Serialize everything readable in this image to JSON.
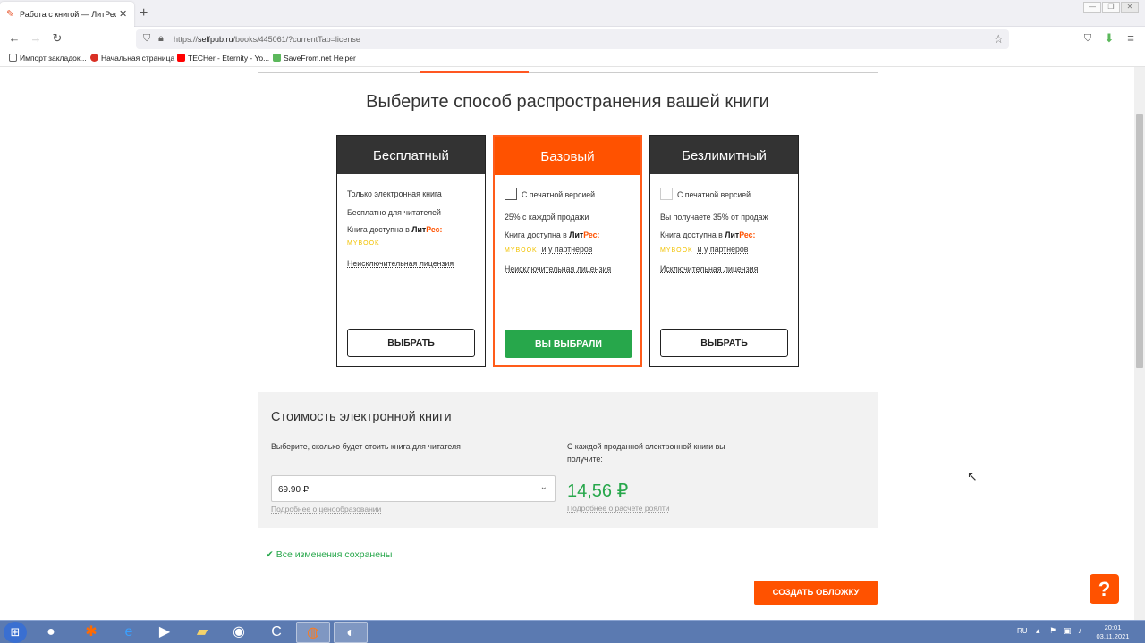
{
  "browser": {
    "tab_title": "Работа с книгой — ЛитРес: Са",
    "url_prefix": "https://",
    "url_host": "selfpub.ru",
    "url_path": "/books/445061/?currentTab=license",
    "bookmarks": [
      {
        "label": "Импорт закладок...",
        "color": "#888888"
      },
      {
        "label": "Начальная страница",
        "color": "#d93025"
      },
      {
        "label": "TECHer - Eternity - Yo...",
        "color": "#ff0000"
      },
      {
        "label": "SaveFrom.net Helper",
        "color": "#5cb85c"
      }
    ]
  },
  "page": {
    "heading": "Выберите способ распространения вашей книги",
    "accent_color": "#ff5200",
    "plans": [
      {
        "name": "Бесплатный",
        "line1": "Только электронная книга",
        "line2": "Бесплатно для читателей",
        "availability": "Книга доступна в",
        "mybook": "MYBOOK",
        "license": "Неисключительная лицензия",
        "button": "ВЫБРАТЬ",
        "selected": false
      },
      {
        "name": "Базовый",
        "print_option": "С печатной версией",
        "royalty": "25% с каждой продажи",
        "availability": "Книга доступна в",
        "mybook": "MYBOOK",
        "partners": "и у партнеров",
        "license": "Неисключительная лицензия",
        "button": "ВЫ ВЫБРАЛИ",
        "selected": true
      },
      {
        "name": "Безлимитный",
        "print_option": "С печатной версией",
        "royalty": "Вы получаете 35% от продаж",
        "availability": "Книга доступна в",
        "mybook": "MYBOOK",
        "partners": "и у партнеров",
        "license": "Исключительная лицензия",
        "button": "ВЫБРАТЬ",
        "selected": false
      }
    ],
    "litres_brand": {
      "lit": "Лит",
      "res": "Рес:"
    },
    "price": {
      "title": "Стоимость электронной книги",
      "subtitle": "Выберите, сколько будет стоить книга для читателя",
      "selected_value": "69.90 ₽",
      "pricing_link": "Подробнее о ценообразовании",
      "royalty_label": "С каждой проданной электронной книги вы получите:",
      "royalty_value": "14,56 ₽",
      "royalty_link": "Подробнее о расчете роялти"
    },
    "saved_status": "Все изменения сохранены",
    "create_cover_button": "СОЗДАТЬ ОБЛОЖКУ",
    "help_button": "?"
  },
  "taskbar": {
    "language": "RU",
    "time": "20:01",
    "date": "03.11.2021"
  }
}
